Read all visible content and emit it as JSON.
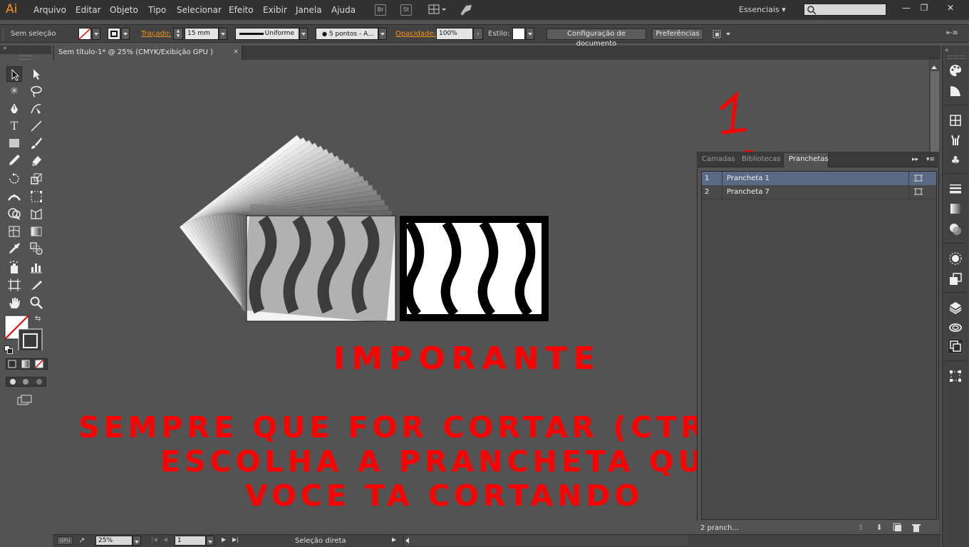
{
  "app": {
    "logo": "Ai"
  },
  "menu": [
    "Arquivo",
    "Editar",
    "Objeto",
    "Tipo",
    "Selecionar",
    "Efeito",
    "Exibir",
    "Janela",
    "Ajuda"
  ],
  "menu_icons": {
    "bridge": "Br",
    "stock": "St"
  },
  "workspace": {
    "label": "Essenciais"
  },
  "window_buttons": {
    "minimize": "—",
    "restore": "❐",
    "close": "✕"
  },
  "control_bar": {
    "selection_state": "Sem seleção",
    "stroke_label": "Traçado:",
    "stroke_value": "15 mm",
    "stroke_profile": "Uniforme",
    "brush": "5 pontos - A...",
    "opacity_label": "Opacidade:",
    "opacity_value": "100%",
    "style_label": "Estilo:",
    "doc_setup_button": "Configuração de documento",
    "preferences_button": "Preferências"
  },
  "document": {
    "tab_title": "Sem título-1* @ 25% (CMYK/Exibição GPU )",
    "tab_close": "×"
  },
  "panel": {
    "tabs": [
      "Camadas",
      "Bibliotecas",
      "Pranchetas"
    ],
    "active_tab": "Pranchetas",
    "artboards": [
      {
        "num": "1",
        "name": "Prancheta 1",
        "selected": true
      },
      {
        "num": "2",
        "name": "Prancheta 7",
        "selected": false
      }
    ],
    "count_label": "2 pranch..."
  },
  "annotations": {
    "marker_number": "1",
    "title": "IMPORANTE",
    "line1": "SEMPRE QUE FOR CORTAR  (CTRL X)",
    "line2": "ESCOLHA A PRANCHETA QUE",
    "line3": "VOCE TA CORTANDO",
    "color": "#ff0000"
  },
  "status_bar": {
    "zoom": "25%",
    "artboard_nav": "1",
    "tool_status": "Seleção direta"
  },
  "colors": {
    "accent_orange": "#f7941d",
    "selection_row": "#5b6a84",
    "canvas_bg": "#535353"
  },
  "icons": {
    "toolbox": [
      "selection-icon",
      "direct-selection-icon",
      "magic-wand-icon",
      "lasso-icon",
      "pen-icon",
      "curvature-icon",
      "type-icon",
      "line-icon",
      "rectangle-icon",
      "paintbrush-icon",
      "pencil-icon",
      "eraser-icon",
      "rotate-icon",
      "scale-icon",
      "width-icon",
      "free-transform-icon",
      "shape-builder-icon",
      "perspective-icon",
      "mesh-icon",
      "gradient-icon",
      "eyedropper-icon",
      "blend-icon",
      "symbol-sprayer-icon",
      "graph-icon",
      "artboard-icon",
      "slice-icon",
      "hand-icon",
      "zoom-icon"
    ],
    "dock": [
      "color-icon",
      "color-guide-icon",
      "swatches-icon",
      "brushes-icon",
      "symbols-icon",
      "stroke-icon",
      "gradient-panel-icon",
      "transparency-icon",
      "appearance-icon",
      "graphic-styles-icon",
      "layers-icon",
      "libraries-icon",
      "artboards-panel-icon",
      "transform-icon"
    ]
  }
}
